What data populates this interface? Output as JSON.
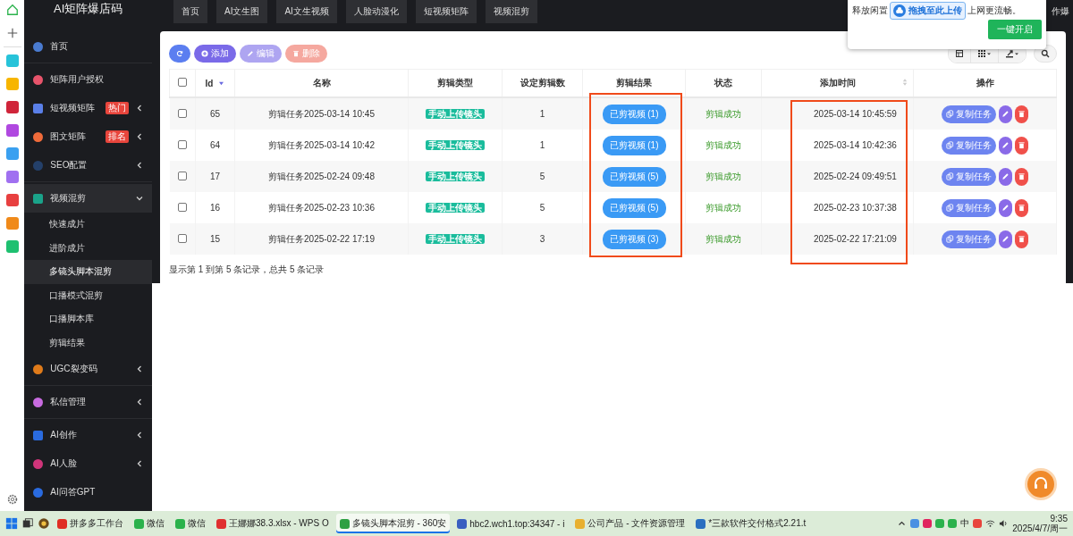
{
  "sidebar": {
    "title": "AI矩阵爆店码",
    "items": [
      {
        "label": "首页",
        "separated": false,
        "has_submenu": false,
        "expanded": false
      },
      {
        "label": "矩阵用户授权",
        "separated": true,
        "has_submenu": false,
        "expanded": false
      },
      {
        "label": "短视频矩阵",
        "badge": "热门",
        "separated": false,
        "has_submenu": true,
        "expanded": false
      },
      {
        "label": "图文矩阵",
        "badge": "排名",
        "separated": false,
        "has_submenu": true,
        "expanded": false
      },
      {
        "label": "SEO配置",
        "separated": false,
        "has_submenu": true,
        "expanded": false
      },
      {
        "label": "视频混剪",
        "separated": true,
        "has_submenu": true,
        "expanded": true,
        "children": [
          {
            "label": "快速成片",
            "selected": false
          },
          {
            "label": "进阶成片",
            "selected": false
          },
          {
            "label": "多镜头脚本混剪",
            "selected": true
          },
          {
            "label": "口播模式混剪",
            "selected": false
          },
          {
            "label": "口播脚本库",
            "selected": false
          },
          {
            "label": "剪辑结果",
            "selected": false
          }
        ]
      },
      {
        "label": "UGC裂变码",
        "separated": false,
        "has_submenu": true,
        "expanded": false
      },
      {
        "label": "私信管理",
        "separated": true,
        "has_submenu": true,
        "expanded": false
      },
      {
        "label": "AI创作",
        "separated": true,
        "has_submenu": true,
        "expanded": false
      },
      {
        "label": "AI人脸",
        "separated": false,
        "has_submenu": true,
        "expanded": false
      },
      {
        "label": "AI问答GPT",
        "separated": false,
        "has_submenu": false,
        "expanded": false
      }
    ]
  },
  "top_nav": {
    "tabs": [
      "首页",
      "AI文生图",
      "AI文生视频",
      "人脸动漫化",
      "短视频矩阵",
      "视频混剪"
    ],
    "cut_text": "作爆"
  },
  "popup": {
    "text_before": "释放闲置",
    "text_after": "上网更流畅。",
    "upload_badge": "拖拽至此上传",
    "button": "一键开启"
  },
  "toolbar": {
    "buttons": [
      {
        "kind": "refresh",
        "disabled": false
      },
      {
        "kind": "add",
        "label": "添加",
        "disabled": false
      },
      {
        "kind": "edit",
        "label": "编辑",
        "disabled": true
      },
      {
        "kind": "delete",
        "label": "删除",
        "disabled": true
      }
    ]
  },
  "table": {
    "select_all_checked": false,
    "columns": [
      {
        "kind": "check"
      },
      {
        "kind": "id",
        "label": "Id",
        "sortable": true,
        "sorted": true
      },
      {
        "kind": "name",
        "label": "名称"
      },
      {
        "kind": "type",
        "label": "剪辑类型"
      },
      {
        "kind": "count",
        "label": "设定剪辑数"
      },
      {
        "kind": "result",
        "label": "剪辑结果",
        "highlighted": true
      },
      {
        "kind": "status",
        "label": "状态"
      },
      {
        "kind": "time",
        "label": "添加时间",
        "sortable": true,
        "sorted": false,
        "highlighted": true
      },
      {
        "kind": "actions",
        "label": "操作"
      }
    ],
    "rows": [
      {
        "checked": false,
        "id": "65",
        "name": "剪辑任务2025-03-14 10:45",
        "type": "手动上传镜头",
        "count": "1",
        "result": "已剪视频 (1)",
        "status": "剪辑成功",
        "time": "2025-03-14 10:45:59",
        "copy": "复制任务"
      },
      {
        "checked": false,
        "id": "64",
        "name": "剪辑任务2025-03-14 10:42",
        "type": "手动上传镜头",
        "count": "1",
        "result": "已剪视频 (1)",
        "status": "剪辑成功",
        "time": "2025-03-14 10:42:36",
        "copy": "复制任务"
      },
      {
        "checked": false,
        "id": "17",
        "name": "剪辑任务2025-02-24 09:48",
        "type": "手动上传镜头",
        "count": "5",
        "result": "已剪视频 (5)",
        "status": "剪辑成功",
        "time": "2025-02-24 09:49:51",
        "copy": "复制任务"
      },
      {
        "checked": false,
        "id": "16",
        "name": "剪辑任务2025-02-23 10:36",
        "type": "手动上传镜头",
        "count": "5",
        "result": "已剪视频 (5)",
        "status": "剪辑成功",
        "time": "2025-02-23 10:37:38",
        "copy": "复制任务"
      },
      {
        "checked": false,
        "id": "15",
        "name": "剪辑任务2025-02-22 17:19",
        "type": "手动上传镜头",
        "count": "3",
        "result": "已剪视频 (3)",
        "status": "剪辑成功",
        "time": "2025-02-22 17:21:09",
        "copy": "复制任务"
      }
    ],
    "footer": "显示第 1 到第 5 条记录，总共 5 条记录"
  },
  "taskbar": {
    "items": [
      {
        "label": "拼多多工作台",
        "selected": false
      },
      {
        "label": "微信",
        "selected": false
      },
      {
        "label": "微信",
        "selected": false
      },
      {
        "label": "王娜娜38.3.xlsx - WPS O",
        "selected": false
      },
      {
        "label": "多镜头脚本混剪 - 360安",
        "selected": true
      },
      {
        "label": "hbc2.wch1.top:34347 - i",
        "selected": false
      },
      {
        "label": "公司产品 - 文件资源管理",
        "selected": false
      },
      {
        "label": "*三款软件交付格式2.21.t",
        "selected": false
      }
    ],
    "ime": "中",
    "time": "9:35",
    "date": "2025/4/7/周一"
  }
}
